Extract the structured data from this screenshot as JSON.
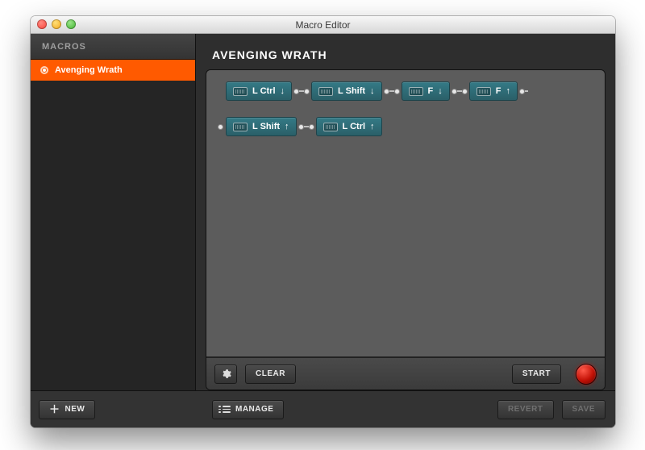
{
  "window": {
    "title": "Macro Editor"
  },
  "sidebar": {
    "header": "MACROS",
    "items": [
      {
        "label": "Avenging Wrath",
        "selected": true
      }
    ],
    "new_label": "NEW"
  },
  "editor": {
    "title": "AVENGING WRATH",
    "steps": [
      {
        "key": "L Ctrl",
        "direction": "down"
      },
      {
        "key": "L Shift",
        "direction": "down"
      },
      {
        "key": "F",
        "direction": "down"
      },
      {
        "key": "F",
        "direction": "up"
      },
      {
        "key": "L Shift",
        "direction": "up"
      },
      {
        "key": "L Ctrl",
        "direction": "up"
      }
    ],
    "clear_label": "CLEAR",
    "start_label": "START"
  },
  "appbar": {
    "manage_label": "MANAGE",
    "revert_label": "REVERT",
    "save_label": "SAVE"
  },
  "icons": {
    "gear": "gear-icon",
    "plus": "plus-icon",
    "list": "hamburger-icon",
    "keyboard": "keyboard-icon",
    "arrow_down": "↓",
    "arrow_up": "↑"
  },
  "colors": {
    "accent": "#ff5a00",
    "step": "#347a86",
    "record": "#c31106"
  }
}
